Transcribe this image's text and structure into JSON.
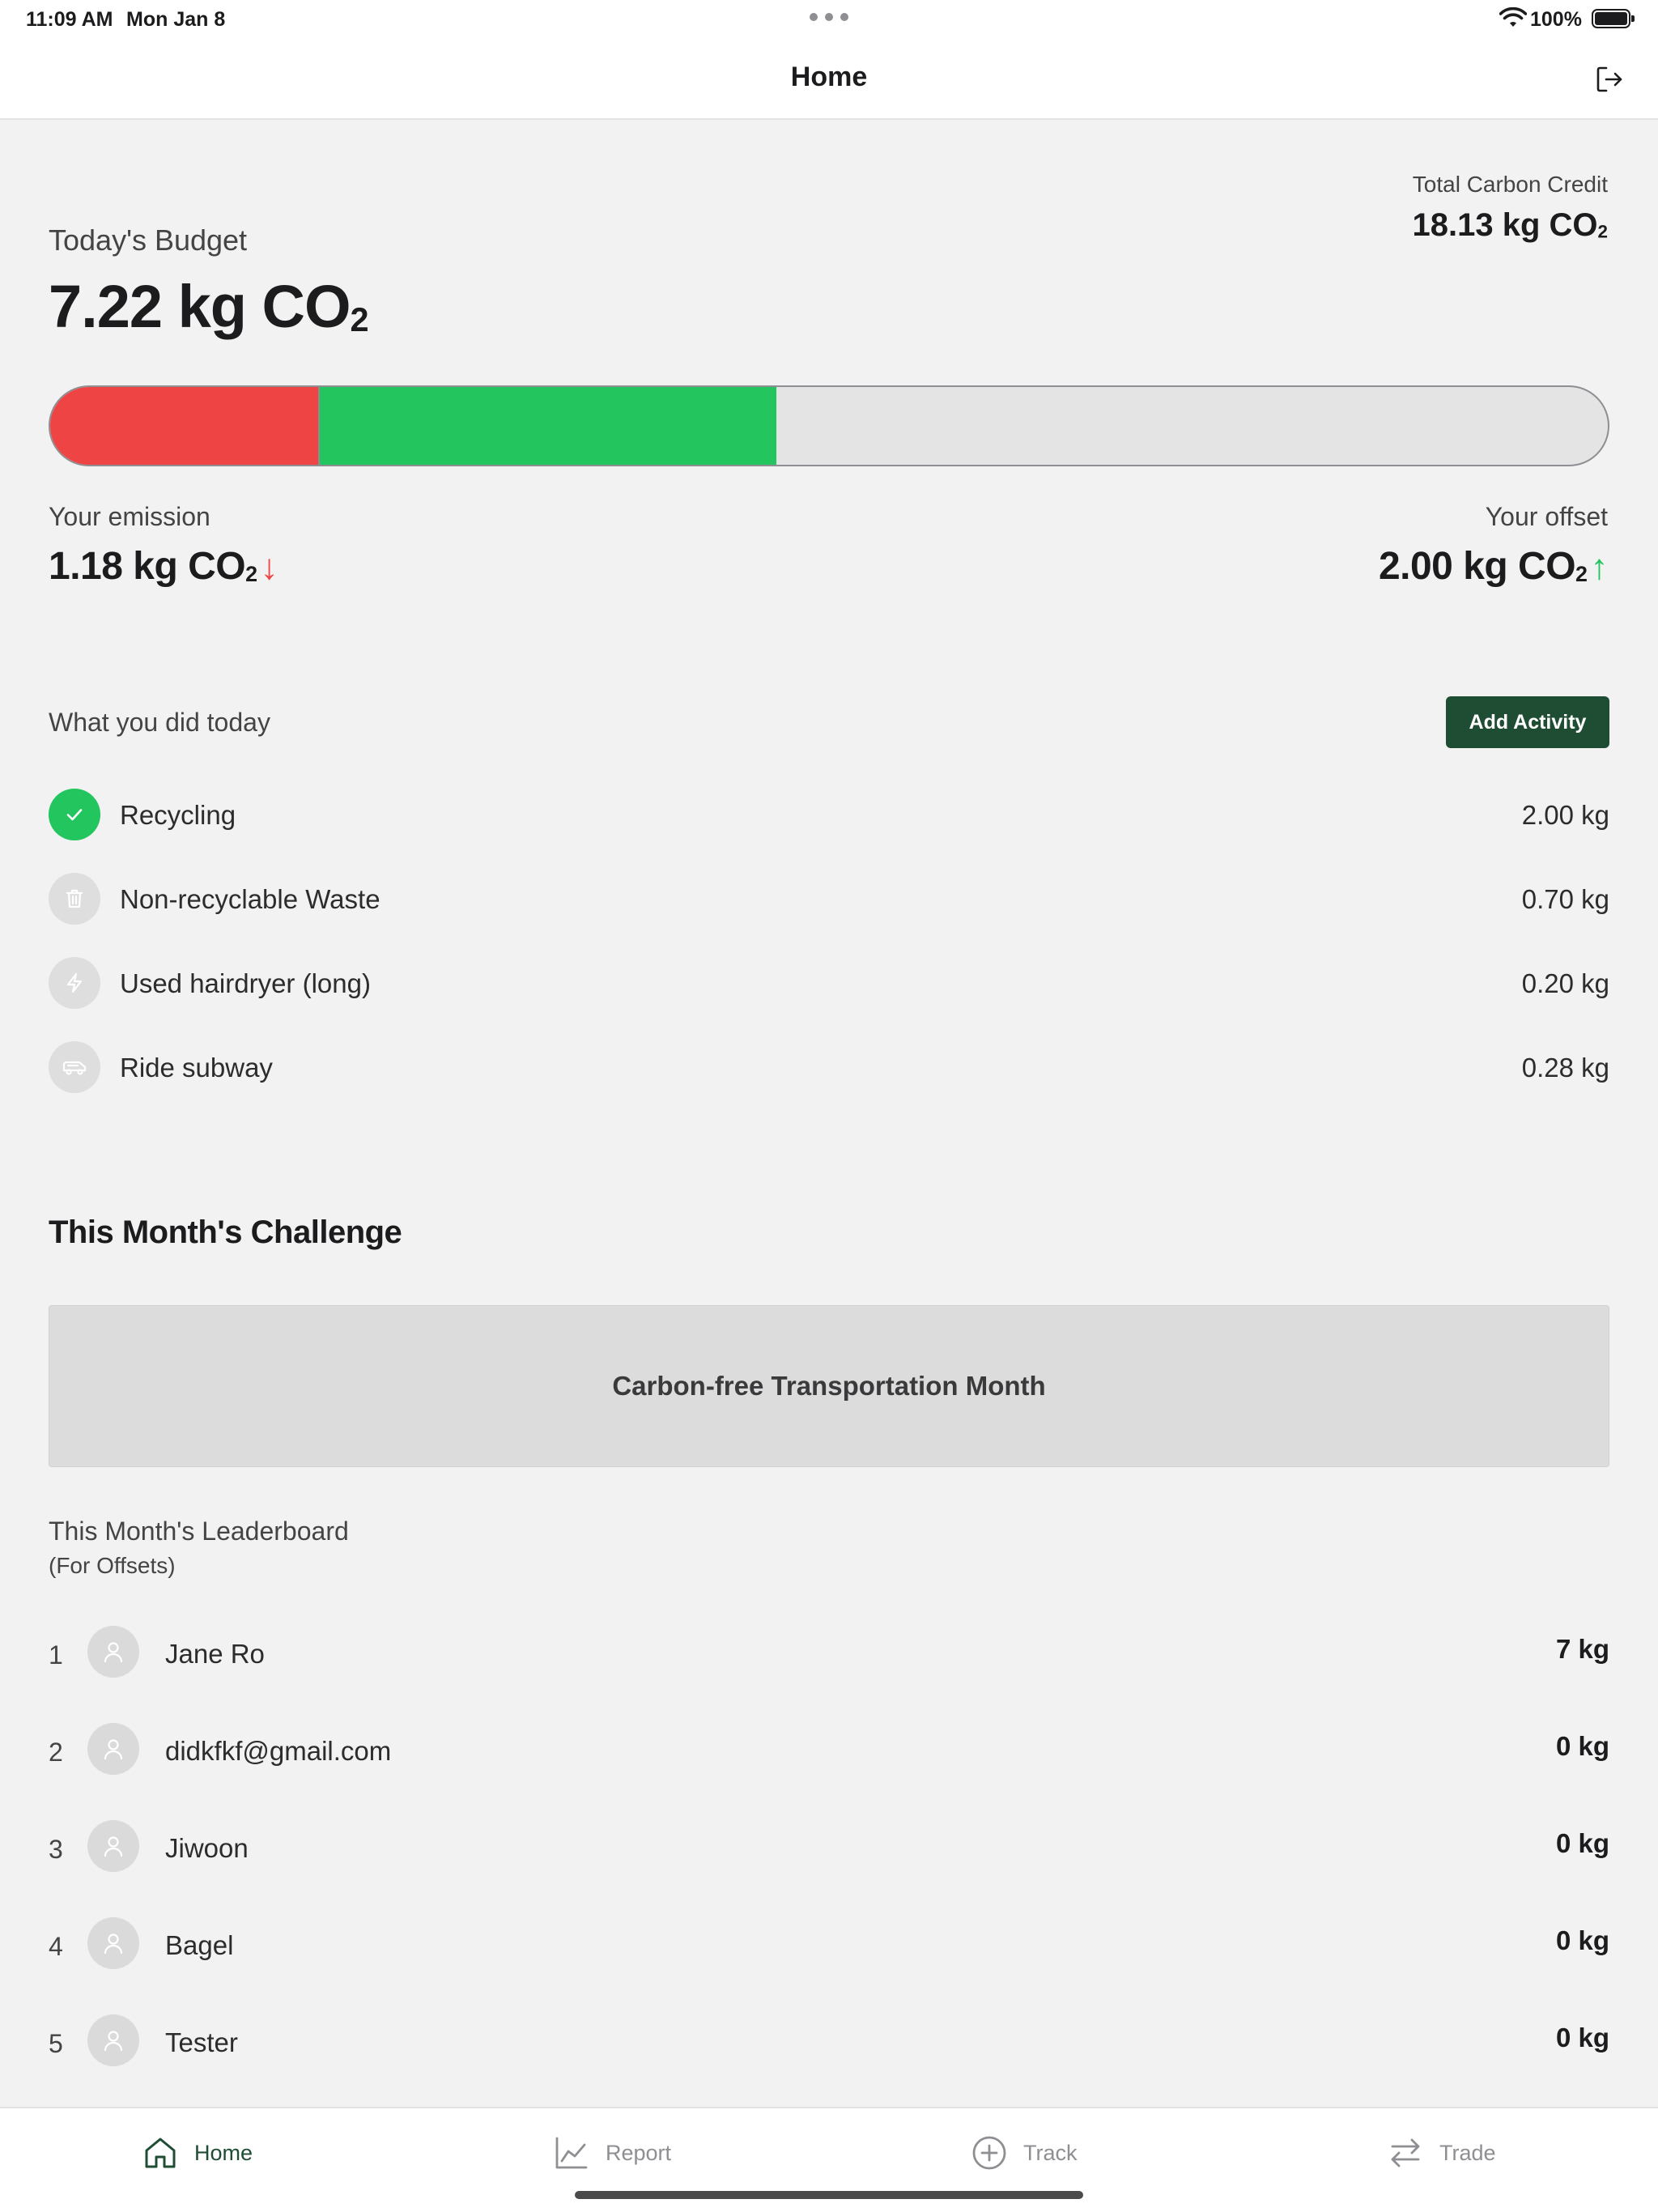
{
  "status_bar": {
    "time": "11:09 AM",
    "date": "Mon Jan 8",
    "battery": "100%"
  },
  "nav": {
    "title": "Home",
    "logout_icon": "logout-icon"
  },
  "budget": {
    "total_credit_label": "Total Carbon Credit",
    "total_credit_value": "18.13 kg CO",
    "total_credit_sub": "2",
    "label": "Today's Budget",
    "value": "7.22 kg CO",
    "value_sub": "2",
    "emission_fraction": 0.173,
    "offset_fraction": 0.293,
    "emission_label": "Your emission",
    "emission_value": "1.18 kg CO",
    "emission_sub": "2",
    "emission_arrow": "↓",
    "offset_label": "Your offset",
    "offset_value": "2.00 kg CO",
    "offset_sub": "2",
    "offset_arrow": "↑"
  },
  "colors": {
    "emission": "#ef4444",
    "offset": "#22c55e",
    "accent": "#1f4d33"
  },
  "activities": {
    "header": "What you did today",
    "add_button": "Add Activity",
    "items": [
      {
        "name": "Recycling",
        "amount": "2.00 kg",
        "icon": "checkmark-icon",
        "done": true
      },
      {
        "name": "Non-recyclable Waste",
        "amount": "0.70 kg",
        "icon": "trash-icon",
        "done": false
      },
      {
        "name": "Used hairdryer (long)",
        "amount": "0.20 kg",
        "icon": "lightning-icon",
        "done": false
      },
      {
        "name": "Ride subway",
        "amount": "0.28 kg",
        "icon": "train-icon",
        "done": false
      }
    ]
  },
  "challenge": {
    "heading": "This Month's Challenge",
    "title": "Carbon-free Transportation Month"
  },
  "leaderboard": {
    "heading": "This Month's Leaderboard",
    "subheading": "(For Offsets)",
    "rows": [
      {
        "rank": "1",
        "name": "Jane Ro",
        "value": "7 kg"
      },
      {
        "rank": "2",
        "name": "didkfkf@gmail.com",
        "value": "0 kg"
      },
      {
        "rank": "3",
        "name": "Jiwoon",
        "value": "0 kg"
      },
      {
        "rank": "4",
        "name": "Bagel",
        "value": "0 kg"
      },
      {
        "rank": "5",
        "name": "Tester",
        "value": "0 kg"
      }
    ]
  },
  "tabs": [
    {
      "label": "Home",
      "icon": "home-icon",
      "active": true
    },
    {
      "label": "Report",
      "icon": "chart-line-icon",
      "active": false
    },
    {
      "label": "Track",
      "icon": "plus-circle-icon",
      "active": false
    },
    {
      "label": "Trade",
      "icon": "swap-arrows-icon",
      "active": false
    }
  ]
}
